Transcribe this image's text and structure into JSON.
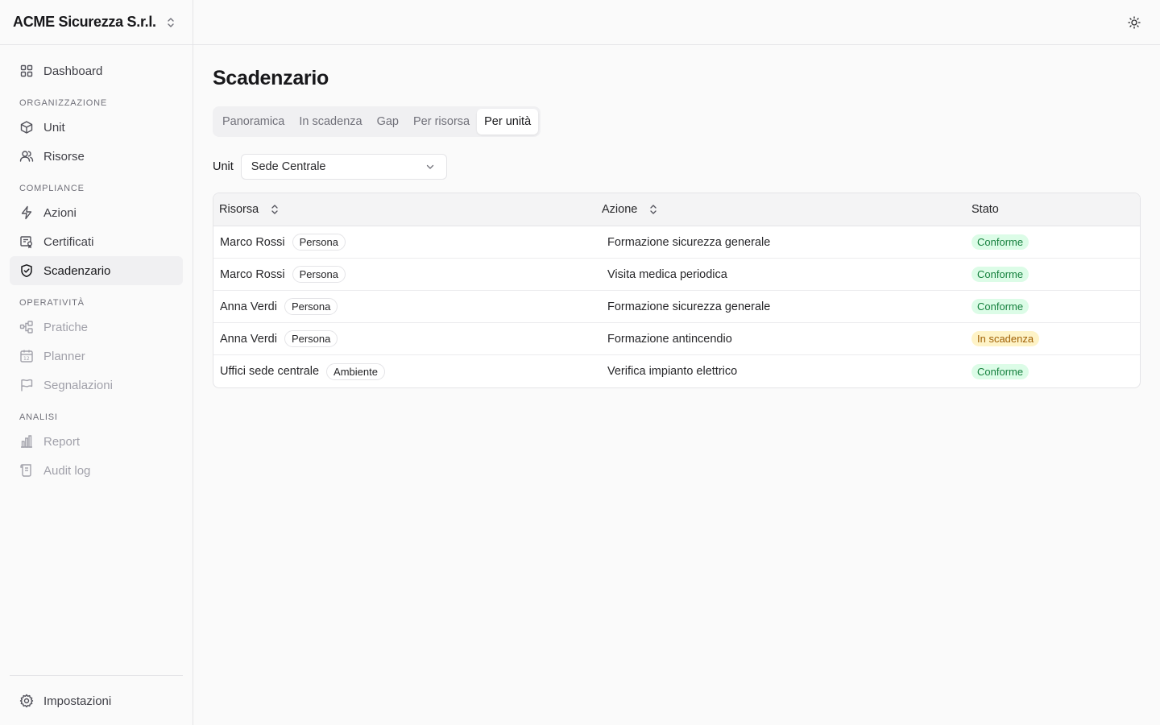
{
  "org": {
    "name": "ACME Sicurezza S.r.l."
  },
  "sidebar": {
    "dashboard": "Dashboard",
    "sections": {
      "organizzazione": "ORGANIZZAZIONE",
      "compliance": "COMPLIANCE",
      "operativita": "OPERATIVITÀ",
      "analisi": "ANALISI"
    },
    "items": {
      "unit": "Unit",
      "risorse": "Risorse",
      "azioni": "Azioni",
      "certificati": "Certificati",
      "scadenzario": "Scadenzario",
      "pratiche": "Pratiche",
      "planner": "Planner",
      "segnalazioni": "Segnalazioni",
      "report": "Report",
      "audit_log": "Audit log"
    },
    "settings": "Impostazioni"
  },
  "page": {
    "title": "Scadenzario"
  },
  "tabs": [
    "Panoramica",
    "In scadenza",
    "Gap",
    "Per risorsa",
    "Per unità"
  ],
  "active_tab": "Per unità",
  "filter": {
    "label": "Unit",
    "value": "Sede Centrale"
  },
  "table": {
    "headers": {
      "risorsa": "Risorsa",
      "azione": "Azione",
      "stato": "Stato"
    },
    "rows": [
      {
        "risorsa": "Marco Rossi",
        "tipo": "Persona",
        "azione": "Formazione sicurezza generale",
        "stato": "Conforme",
        "status_kind": "ok"
      },
      {
        "risorsa": "Marco Rossi",
        "tipo": "Persona",
        "azione": "Visita medica periodica",
        "stato": "Conforme",
        "status_kind": "ok"
      },
      {
        "risorsa": "Anna Verdi",
        "tipo": "Persona",
        "azione": "Formazione sicurezza generale",
        "stato": "Conforme",
        "status_kind": "ok"
      },
      {
        "risorsa": "Anna Verdi",
        "tipo": "Persona",
        "azione": "Formazione antincendio",
        "stato": "In scadenza",
        "status_kind": "warn"
      },
      {
        "risorsa": "Uffici sede centrale",
        "tipo": "Ambiente",
        "azione": "Verifica impianto elettrico",
        "stato": "Conforme",
        "status_kind": "ok"
      }
    ]
  },
  "colors": {
    "ok_bg": "#dcfce7",
    "ok_text": "#15803d",
    "warn_bg": "#fef3c7",
    "warn_text": "#a16207"
  }
}
